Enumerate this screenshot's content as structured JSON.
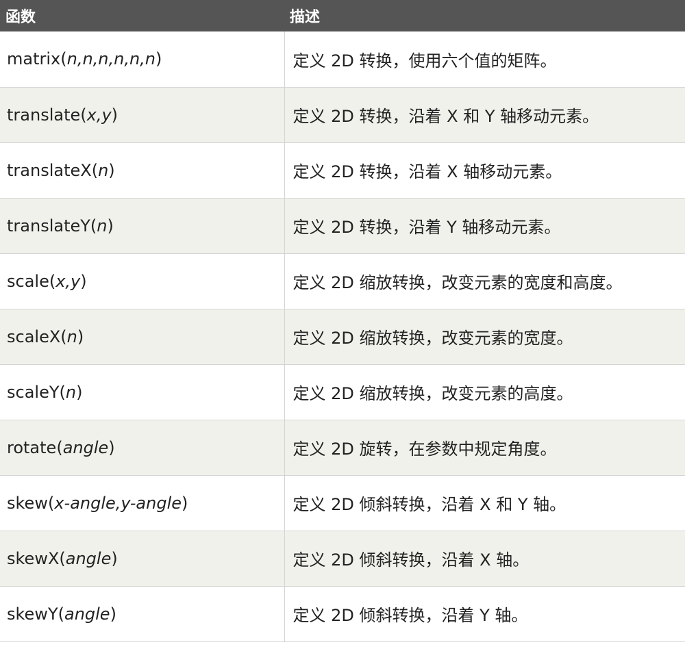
{
  "table": {
    "headers": {
      "function": "函数",
      "description": "描述"
    },
    "rows": [
      {
        "name": "matrix",
        "args": "n,n,n,n,n,n",
        "description": "定义 2D 转换，使用六个值的矩阵。"
      },
      {
        "name": "translate",
        "args": "x,y",
        "description": "定义 2D 转换，沿着 X 和 Y 轴移动元素。"
      },
      {
        "name": "translateX",
        "args": "n",
        "description": "定义 2D 转换，沿着 X 轴移动元素。"
      },
      {
        "name": "translateY",
        "args": "n",
        "description": "定义 2D 转换，沿着 Y 轴移动元素。"
      },
      {
        "name": "scale",
        "args": "x,y",
        "description": "定义 2D 缩放转换，改变元素的宽度和高度。"
      },
      {
        "name": "scaleX",
        "args": "n",
        "description": "定义 2D 缩放转换，改变元素的宽度。"
      },
      {
        "name": "scaleY",
        "args": "n",
        "description": "定义 2D 缩放转换，改变元素的高度。"
      },
      {
        "name": "rotate",
        "args": "angle",
        "description": "定义 2D 旋转，在参数中规定角度。"
      },
      {
        "name": "skew",
        "args": "x-angle,y-angle",
        "description": "定义 2D 倾斜转换，沿着 X 和 Y 轴。"
      },
      {
        "name": "skewX",
        "args": "angle",
        "description": "定义 2D 倾斜转换，沿着 X 轴。"
      },
      {
        "name": "skewY",
        "args": "angle",
        "description": "定义 2D 倾斜转换，沿着 Y 轴。"
      }
    ]
  }
}
